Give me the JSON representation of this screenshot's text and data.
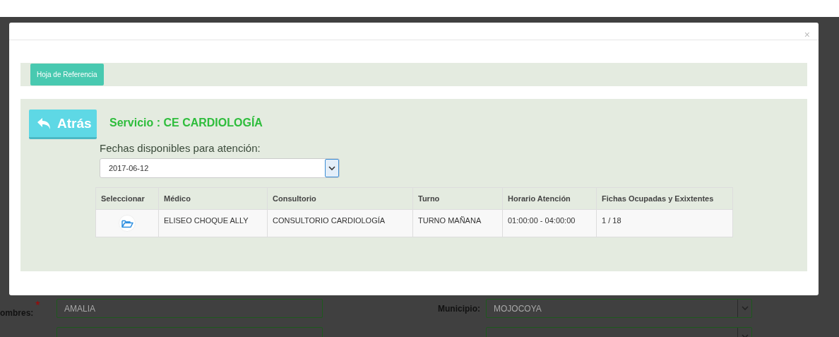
{
  "background_form": {
    "rows": [
      {
        "fields": [
          {
            "label": "ombres:",
            "required_mark": "*",
            "kind": "text",
            "value": "AMALIA"
          },
          {
            "label": "Municipio:",
            "kind": "select",
            "value": "MOJOCOYA"
          }
        ]
      },
      {
        "fields": [
          {
            "kind": "text"
          },
          {
            "kind": "select"
          }
        ]
      }
    ]
  },
  "modal": {
    "close": "×",
    "toolbar": {
      "button": "Hoja de Referencia"
    },
    "back_button": "Atrás",
    "service": "Servicio : CE CARDIOLOGÍA",
    "dates_label": "Fechas disponibles para atención:",
    "date_select": {
      "value": "2017-06-12"
    },
    "table": {
      "columns": [
        "Seleccionar",
        "Médico",
        "Consultorio",
        "Turno",
        "Horario Atención",
        "Fichas Ocupadas y Exixtentes"
      ],
      "rows": [
        {
          "select": {
            "kind": "folder"
          },
          "cells": [
            "",
            "ELISEO CHOQUE ALLY",
            "CONSULTORIO CARDIOLOGÍA",
            "TURNO MAÑANA",
            "01:00:00 - 04:00:00",
            "1 / 18"
          ]
        }
      ]
    }
  }
}
